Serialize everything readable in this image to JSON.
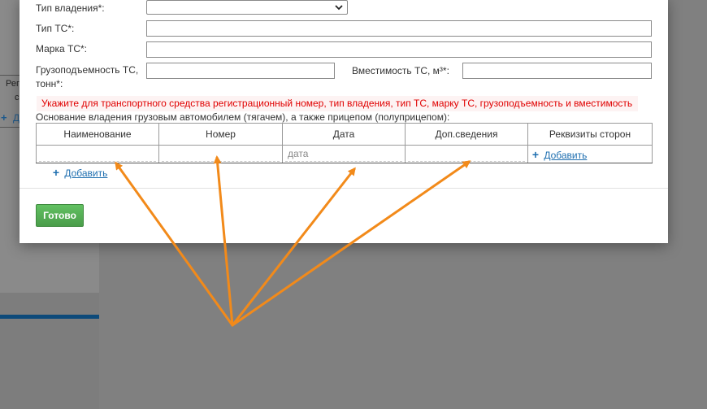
{
  "background": {
    "text_line1": "Рег",
    "text_line2": "с",
    "link_label": "Д"
  },
  "form": {
    "ownership_type_label": "Тип владения*:",
    "ownership_type_value": "",
    "vehicle_type_label": "Тип ТС*:",
    "vehicle_brand_label": "Марка ТС*:",
    "capacity_label_line1": "Грузоподъемность ТС,",
    "capacity_label_line2": "тонн*:",
    "volume_label": "Вместимость ТС, м³*:",
    "notice": "Укажите для транспортного средства регистрационный номер, тип владения, тип ТС, марку ТС, грузоподъемность и вместимость",
    "basis_label": "Основание владения грузовым автомобилем (тягачем), а также прицепом (полуприцепом):"
  },
  "table": {
    "headers": [
      "Наименование",
      "Номер",
      "Дата",
      "Доп.сведения",
      "Реквизиты сторон"
    ],
    "row": {
      "name": "",
      "number": "",
      "date_placeholder": "дата",
      "extra": "",
      "parties_add_label": "Добавить"
    }
  },
  "add_row_label": "Добавить",
  "done_button_label": "Готово",
  "colors": {
    "accent_green": "#5cb85c",
    "notice_red": "#e00000",
    "link_blue": "#1f6fb0",
    "arrow_orange": "#f28a1a"
  },
  "icons": [
    "plus-icon",
    "chevron-down-icon",
    "arrow-annotation"
  ]
}
